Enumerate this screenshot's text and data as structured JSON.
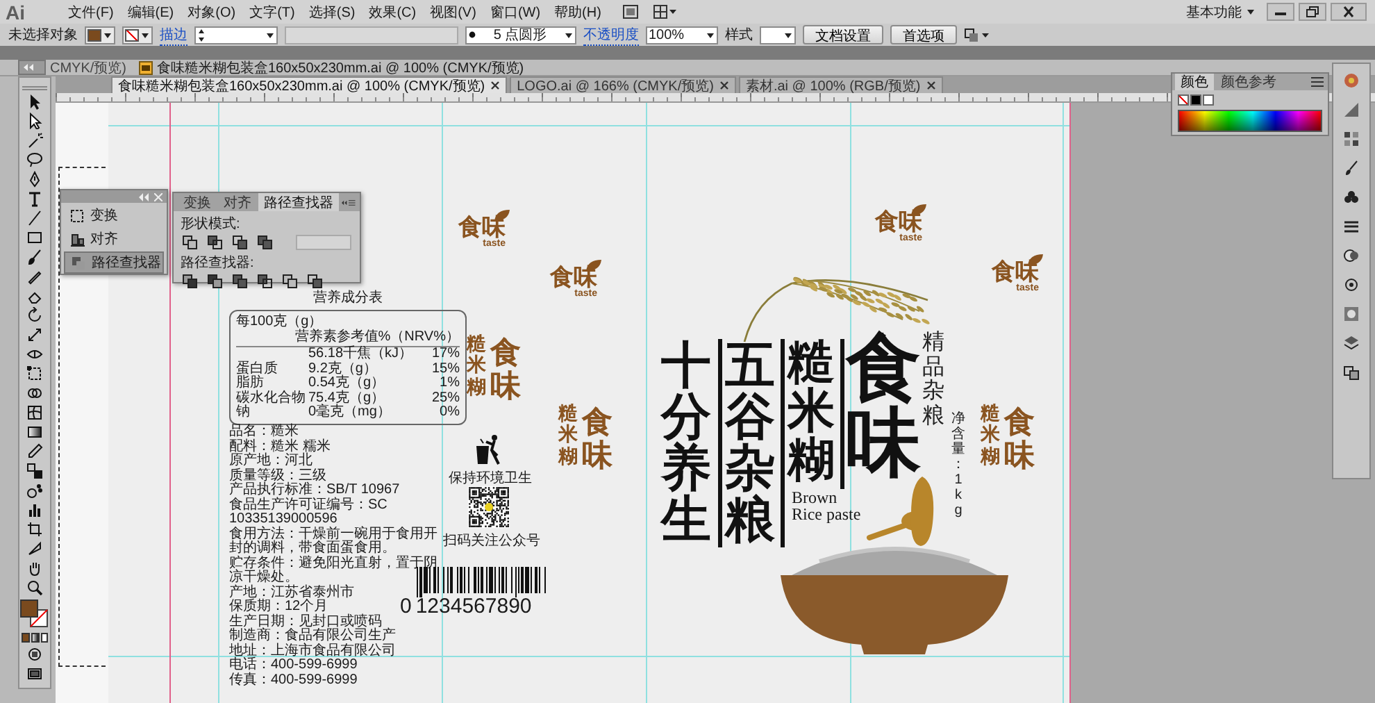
{
  "menu_bar": {
    "logo": "Ai",
    "menus": [
      "文件(F)",
      "编辑(E)",
      "对象(O)",
      "文字(T)",
      "选择(S)",
      "效果(C)",
      "视图(V)",
      "窗口(W)",
      "帮助(H)"
    ],
    "workspace": "基本功能"
  },
  "control_bar": {
    "selection": "未选择对象",
    "stroke_label": "描边",
    "brush": "5 点圆形",
    "opacity_label": "不透明度",
    "opacity": "100%",
    "style_label": "样式",
    "buttons": [
      "文档设置",
      "首选项"
    ]
  },
  "background_window": {
    "partial_title": "CMYK/预览)",
    "title": "食味糙米糊包装盒160x50x230mm.ai @ 100% (CMYK/预览)"
  },
  "document_tabs": [
    {
      "label": "食味糙米糊包装盒160x50x230mm.ai @ 100% (CMYK/预览)",
      "selected": true
    },
    {
      "label": "LOGO.ai @ 166% (CMYK/预览)",
      "selected": false
    },
    {
      "label": "素材.ai @ 100% (RGB/预览)",
      "selected": false
    }
  ],
  "panel_dock": {
    "items": [
      {
        "label": "变换",
        "selected": false
      },
      {
        "label": "对齐",
        "selected": false
      },
      {
        "label": "路径查找器",
        "selected": true
      }
    ]
  },
  "pathfinder_panel": {
    "tabs": [
      {
        "label": "变换",
        "selected": false
      },
      {
        "label": "对齐",
        "selected": false
      },
      {
        "label": "路径查找器",
        "selected": true
      }
    ],
    "shape_modes_label": "形状模式:",
    "pathfinders_label": "路径查找器:"
  },
  "color_panel": {
    "tabs": [
      {
        "label": "颜色",
        "selected": true
      },
      {
        "label": "颜色参考",
        "selected": false
      }
    ]
  },
  "artboard": {
    "logos": [
      {
        "brand": "食味",
        "sub": "taste"
      },
      {
        "brand": "食味",
        "sub": "taste"
      },
      {
        "brand": "食味",
        "sub": "taste"
      },
      {
        "brand": "食味",
        "sub": "taste"
      }
    ],
    "side_brands": [
      {
        "product": "糙米糊",
        "brand": "食味"
      },
      {
        "product": "糙米糊",
        "brand": "食味"
      },
      {
        "product": "糙米糊",
        "brand": "食味"
      }
    ],
    "nutrition": {
      "title": "营养成分表",
      "columns": [
        "每100克（g）",
        "营养素参考值%（NRV%）"
      ],
      "rows": [
        {
          "per_100g": "56.18千焦（kJ）",
          "nrv": "17%"
        },
        {
          "item": "蛋白质",
          "per_100g": "9.2克（g）",
          "nrv": "15%"
        },
        {
          "item": "脂肪",
          "per_100g": "0.54克（g）",
          "nrv": "1%"
        },
        {
          "item": "碳水化合物",
          "per_100g": "75.4克（g）",
          "nrv": "25%"
        },
        {
          "item": "钠",
          "per_100g": "0毫克（mg）",
          "nrv": "0%"
        }
      ]
    },
    "info_lines": [
      "品名：糙米",
      "配料：糙米 糯米",
      "原产地：河北",
      "质量等级：三级",
      "产品执行标准：SB/T 10967",
      "食品生产许可证编号：SC 10335139000596",
      "食用方法：干燥前一碗用于食用开封的调料，带食面蛋食用。",
      "贮存条件：避免阳光直射，置于阴凉干燥处。",
      "产地：江苏省泰州市",
      "保质期：12个月",
      "生产日期：见封口或喷码",
      "制造商：食品有限公司生产",
      "地址：上海市食品有限公司",
      "电话：400-599-6999",
      "传真：400-599-6999"
    ],
    "recycle_caption": "保持环境卫生",
    "qr_caption": "扫码关注公众号",
    "barcode": {
      "lead": "0",
      "digits": "1234567890"
    },
    "front": {
      "columns": [
        "十分养生",
        "五谷杂粮",
        "糙米糊"
      ],
      "brand": "食味",
      "tagline": "精品杂粮",
      "net_content": "净含量：1kg",
      "english": [
        "Brown",
        "Rice paste"
      ]
    }
  }
}
